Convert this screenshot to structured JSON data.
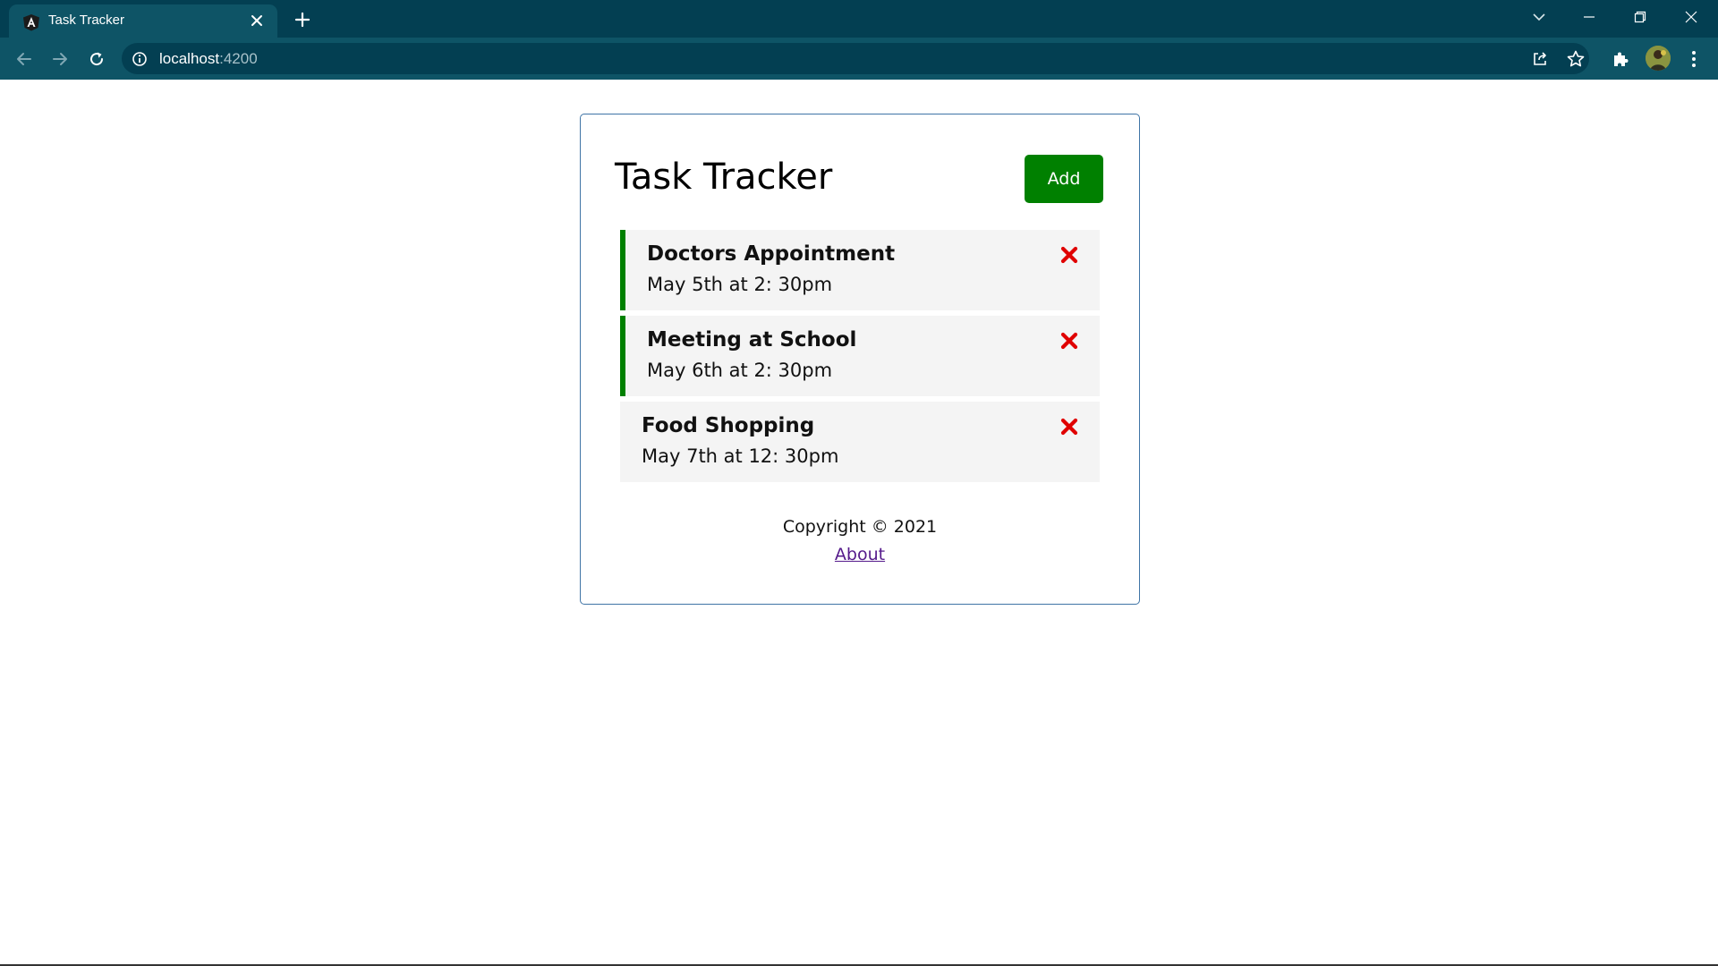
{
  "browser": {
    "tab_title": "Task Tracker",
    "url_host": "localhost",
    "url_port": ":4200",
    "colors": {
      "frame": "#033f52",
      "toolbar": "#0e5466"
    },
    "icons": [
      "angular-favicon-icon",
      "close-icon",
      "plus-icon",
      "chevron-down-icon",
      "minimize-icon",
      "restore-icon",
      "back-arrow-icon",
      "forward-arrow-icon",
      "reload-icon",
      "info-icon",
      "share-icon",
      "star-icon",
      "puzzle-icon",
      "kebab-menu-icon"
    ]
  },
  "app": {
    "title": "Task Tracker",
    "add_label": "Add",
    "accent": "#008000",
    "delete_color": "#e00000",
    "tasks": [
      {
        "text": "Doctors Appointment",
        "day": "May 5th at 2: 30pm",
        "reminder": true
      },
      {
        "text": "Meeting at School",
        "day": "May 6th at 2: 30pm",
        "reminder": true
      },
      {
        "text": "Food Shopping",
        "day": "May 7th at 12: 30pm",
        "reminder": false
      }
    ],
    "footer": {
      "copyright": "Copyright © 2021",
      "about": "About"
    }
  }
}
